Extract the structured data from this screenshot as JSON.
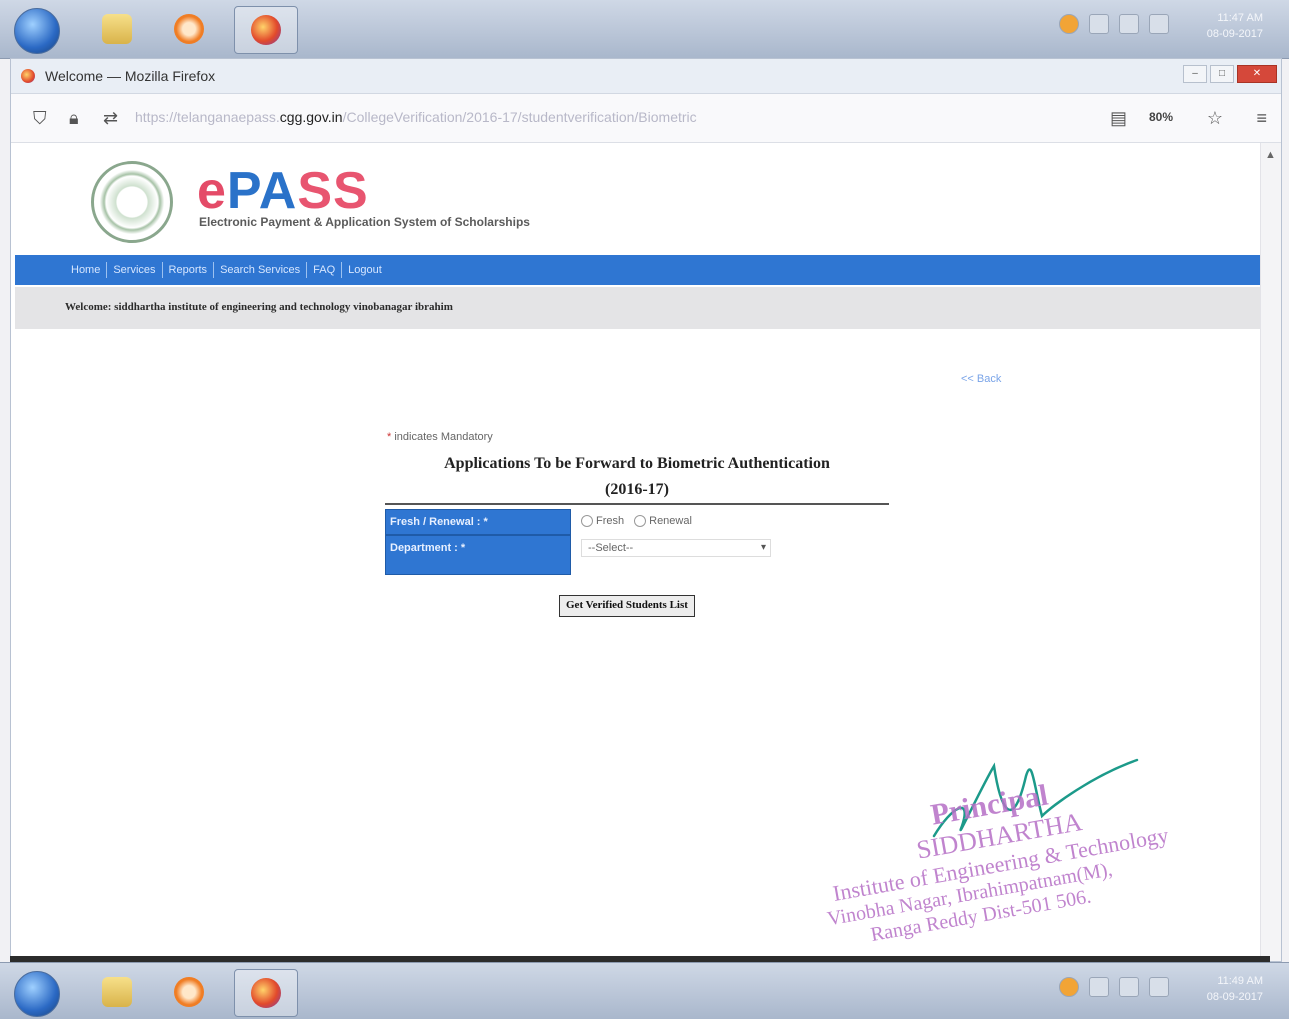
{
  "taskbar": {
    "apps": [
      "windows-start",
      "explorer",
      "media-player",
      "firefox"
    ],
    "clock_time": "11:47 AM",
    "clock_date": "08-09-2017",
    "clock_time_bottom": "11:49 AM"
  },
  "browser": {
    "window_title": "Welcome — Mozilla Firefox",
    "url_prefix": "https://telanganaepass.",
    "url_domain": "cgg.gov.in",
    "url_path": "/CollegeVerification/2016-17/studentverification/Biometric",
    "zoom": "80%"
  },
  "site": {
    "brand_e": "e",
    "brand_pass_p": "PA",
    "brand_ss": "SS",
    "tagline": "Electronic Payment & Application System of Scholarships",
    "menu": [
      "Home",
      "Services",
      "Reports",
      "Search Services",
      "FAQ",
      "Logout"
    ],
    "welcome": "Welcome: siddhartha institute of engineering and technology vinobanagar ibrahim"
  },
  "form": {
    "back_link": "<< Back",
    "mandatory_star": "*",
    "mandatory_text": "indicates Mandatory",
    "title_line1": "Applications To be Forward to Biometric Authentication",
    "title_line2": "(2016-17)",
    "fresh_label": "Fresh / Renewal : *",
    "fresh_option": "Fresh",
    "renewal_option": "Renewal",
    "department_label": "Department : *",
    "department_value": "--Select--",
    "submit_label": "Get Verified Students List"
  },
  "stamp": {
    "line1": "Principal",
    "line2": "SIDDHARTHA",
    "line3": "Institute of Engineering & Technology",
    "line4": "Vinobha Nagar, Ibrahimpatnam(M),",
    "line5": "Ranga Reddy Dist-501 506."
  }
}
